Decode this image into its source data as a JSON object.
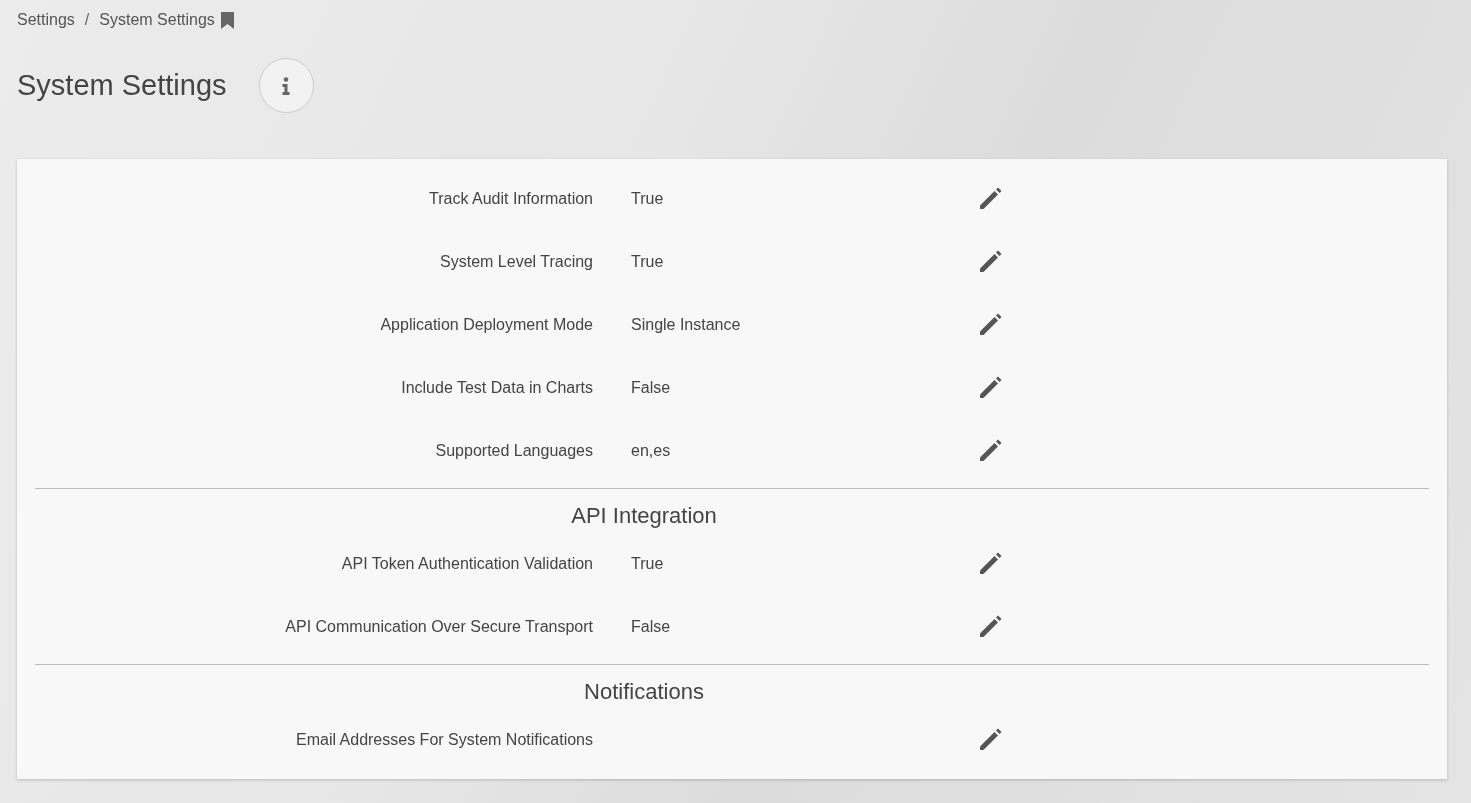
{
  "breadcrumb": [
    "Settings",
    "System Settings"
  ],
  "breadcrumb_separator": "/",
  "title": "System Settings",
  "sections": [
    {
      "settings": [
        {
          "label": "Track Audit Information",
          "value": "True"
        },
        {
          "label": "System Level Tracing",
          "value": "True"
        },
        {
          "label": "Application Deployment Mode",
          "value": "Single Instance"
        },
        {
          "label": "Include Test Data in Charts",
          "value": "False"
        },
        {
          "label": "Supported Languages",
          "value": "en,es"
        }
      ]
    },
    {
      "heading": "API Integration",
      "settings": [
        {
          "label": "API Token Authentication Validation",
          "value": "True"
        },
        {
          "label": "API Communication Over Secure Transport",
          "value": "False"
        }
      ]
    },
    {
      "heading": "Notifications",
      "settings": [
        {
          "label": "Email Addresses For System Notifications"
        }
      ]
    }
  ]
}
